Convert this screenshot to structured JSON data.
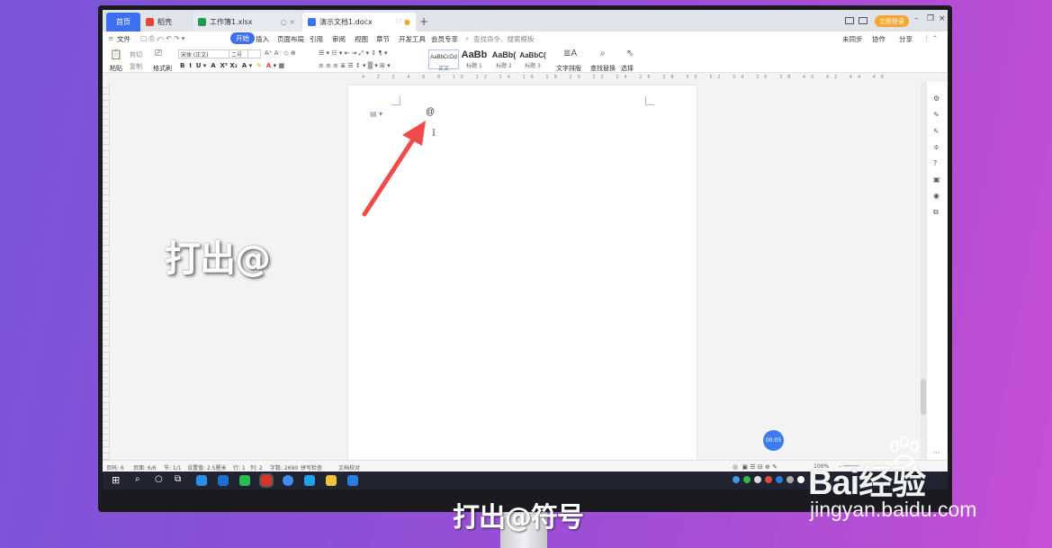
{
  "window": {
    "tabs": [
      {
        "label": "首页"
      },
      {
        "label": "稻壳"
      },
      {
        "label": "工作簿1.xlsx"
      },
      {
        "label": "演示文档1.docx"
      }
    ],
    "login_label": "立即登录"
  },
  "menu": {
    "file_label": "文件",
    "items": [
      "开始",
      "插入",
      "页面布局",
      "引用",
      "审阅",
      "视图",
      "章节",
      "开发工具",
      "会员专享"
    ],
    "search_placeholder": "查找命令、搜索模板",
    "right": [
      "未同步",
      "协作",
      "分享"
    ]
  },
  "ribbon": {
    "paste": "粘贴",
    "cut": "剪切",
    "copy": "复制",
    "format_painter": "格式刷",
    "font_name": "宋体 (正文)",
    "font_size": "二号",
    "styles": [
      {
        "sample": "AaBbCcDd",
        "label": "正文"
      },
      {
        "sample": "AaBb",
        "label": "标题 1"
      },
      {
        "sample": "AaBb(",
        "label": "标题 2"
      },
      {
        "sample": "AaBbC(",
        "label": "标题 3"
      }
    ],
    "text_layout": "文字排版",
    "find_replace": "查找替换",
    "select": "选择"
  },
  "document": {
    "typed_char": "@"
  },
  "timer": "00:05",
  "statusbar": {
    "page": "页码: 6",
    "pages": "页面: 6/6",
    "section": "节: 1/1",
    "setting": "设置值: 2.5厘米",
    "row": "行: 1",
    "col": "列: 2",
    "words": "字数: 2690",
    "spell": "拼写检查",
    "proof": "文档校对",
    "zoom": "100%"
  },
  "overlay": {
    "big_text": "打出@",
    "caption": "打出@符号"
  },
  "watermark": {
    "brand": "Bai经验",
    "url": "jingyan.baidu.com"
  },
  "colors": {
    "accent": "#3d6ff0",
    "arrow": "#f04a4a",
    "login": "#f3a632"
  }
}
